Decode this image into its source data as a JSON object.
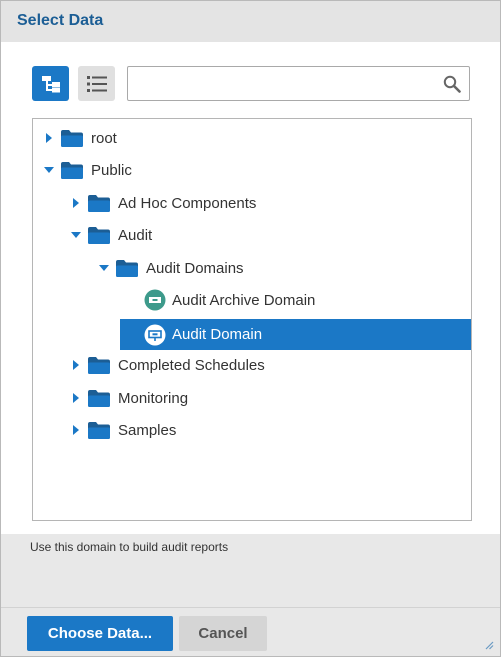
{
  "dialog": {
    "title": "Select Data"
  },
  "toolbar": {
    "tree_view_icon": "tree-view-icon",
    "list_view_icon": "list-view-icon",
    "search_placeholder": "",
    "search_value": "",
    "search_icon": "magnifier-icon"
  },
  "tree": {
    "nodes": [
      {
        "label": "root",
        "type": "folder",
        "expanded": false
      },
      {
        "label": "Public",
        "type": "folder",
        "expanded": true
      },
      {
        "label": "Ad Hoc Components",
        "type": "folder",
        "expanded": false
      },
      {
        "label": "Audit",
        "type": "folder",
        "expanded": true
      },
      {
        "label": "Audit Domains",
        "type": "folder",
        "expanded": true
      },
      {
        "label": "Audit Archive Domain",
        "type": "domain",
        "selected": false
      },
      {
        "label": "Audit Domain",
        "type": "domain",
        "selected": true
      },
      {
        "label": "Completed Schedules",
        "type": "folder",
        "expanded": false
      },
      {
        "label": "Monitoring",
        "type": "folder",
        "expanded": false
      },
      {
        "label": "Samples",
        "type": "folder",
        "expanded": false
      }
    ]
  },
  "description": "Use this domain to build audit reports",
  "buttons": {
    "choose_label": "Choose Data...",
    "cancel_label": "Cancel"
  },
  "colors": {
    "accent": "#1b78c6",
    "title": "#1c5e95",
    "domain_icon": "#3d9a8b"
  }
}
